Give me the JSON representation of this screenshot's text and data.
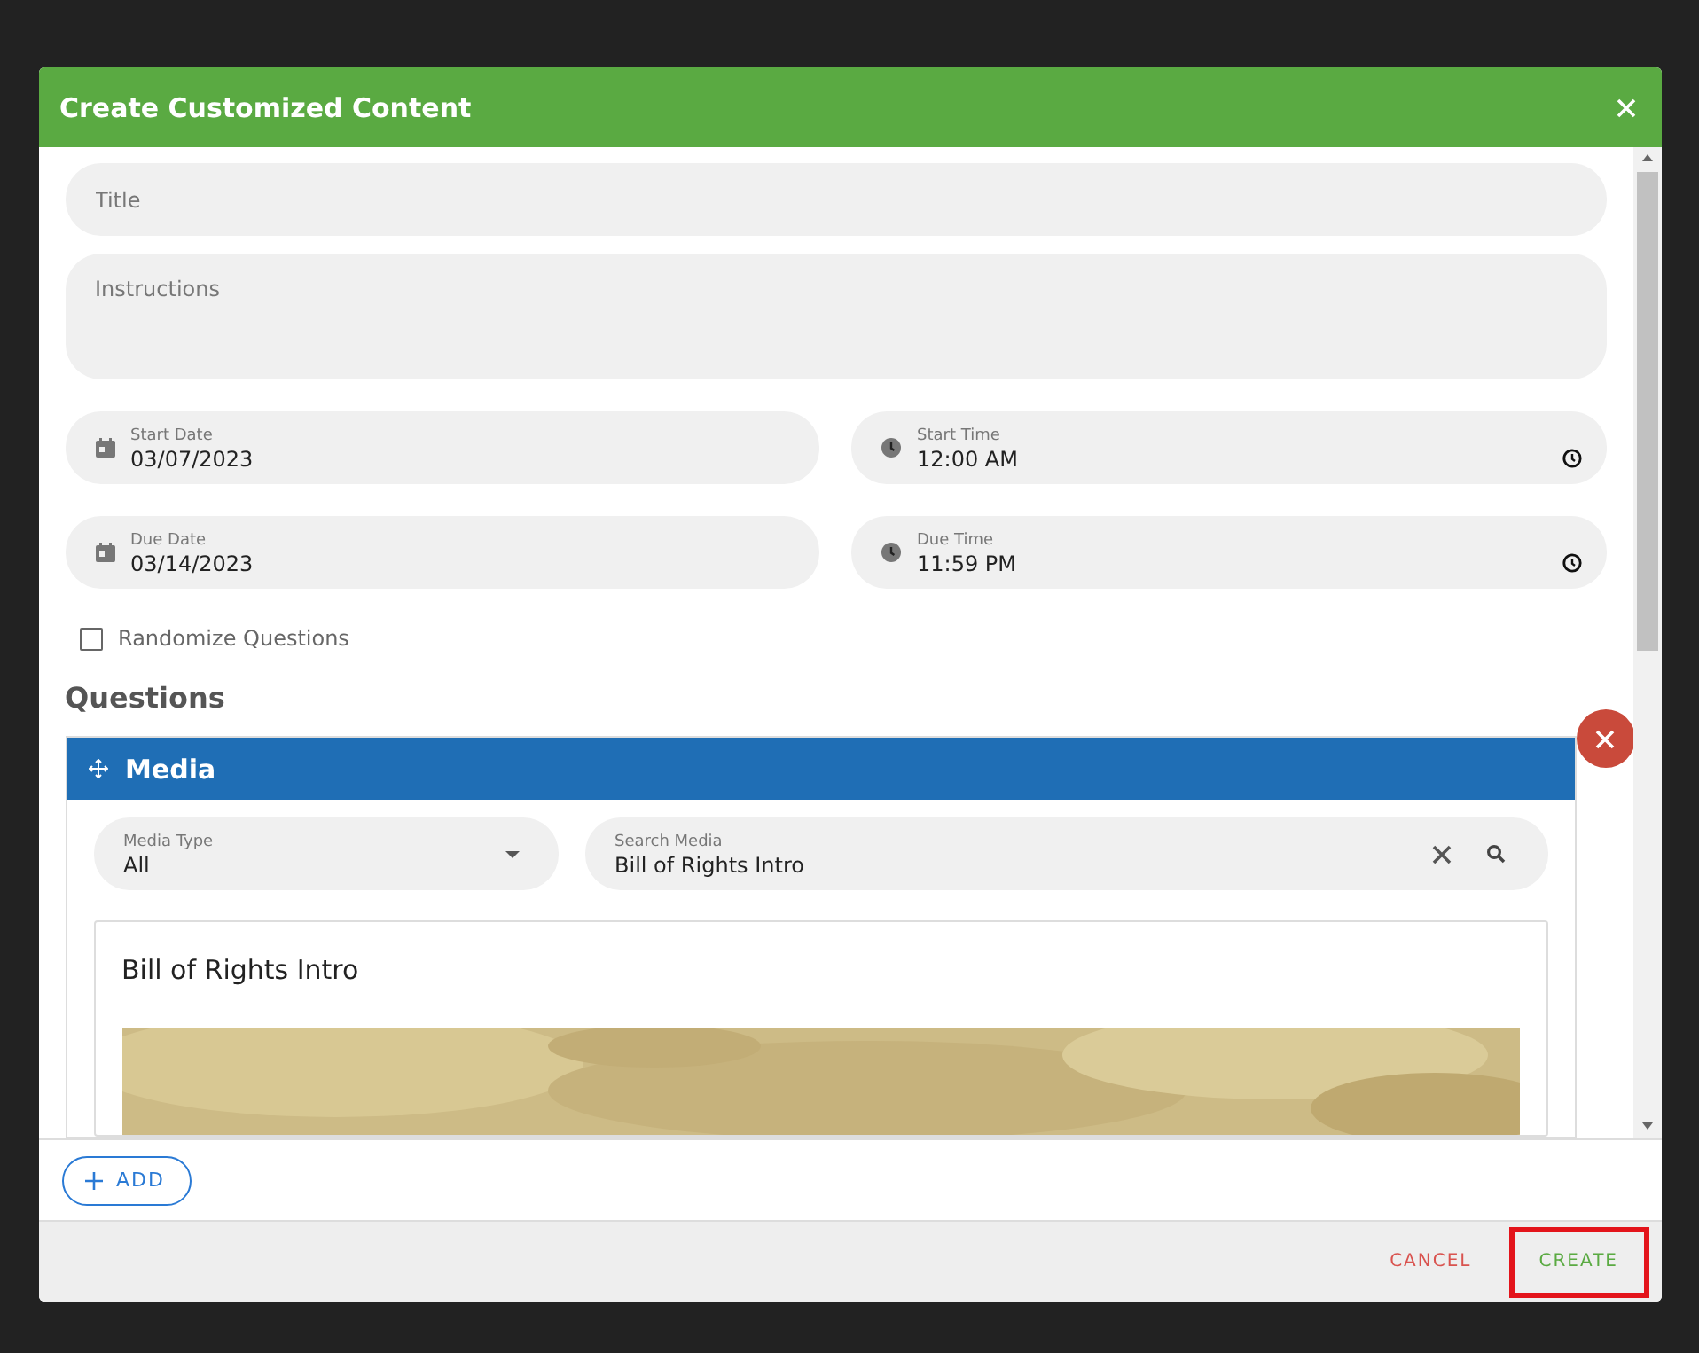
{
  "dialog": {
    "title": "Create Customized Content"
  },
  "title_field": {
    "placeholder": "Title"
  },
  "instructions_field": {
    "placeholder": "Instructions"
  },
  "schedule": [
    {
      "kind": "date",
      "label": "Start Date",
      "value": "03/07/2023"
    },
    {
      "kind": "time",
      "label": "Start Time",
      "value": "12:00 AM"
    },
    {
      "kind": "date",
      "label": "Due Date",
      "value": "03/14/2023"
    },
    {
      "kind": "time",
      "label": "Due Time",
      "value": "11:59 PM"
    }
  ],
  "randomize": {
    "label": "Randomize Questions",
    "checked": false
  },
  "questions": {
    "heading": "Questions",
    "items": [
      {
        "kind": "media",
        "title": "Media",
        "media_type": {
          "label": "Media Type",
          "value": "All"
        },
        "search": {
          "label": "Search Media",
          "value": "Bill of Rights Intro"
        },
        "result": {
          "title": "Bill of Rights Intro",
          "kind": "picture"
        }
      }
    ]
  },
  "add_button": {
    "label": "ADD"
  },
  "footer": {
    "buttons": [
      {
        "label": "CANCEL",
        "kind": "cancel",
        "highlighted": false
      },
      {
        "label": "CREATE",
        "kind": "create",
        "highlighted": true
      }
    ]
  }
}
